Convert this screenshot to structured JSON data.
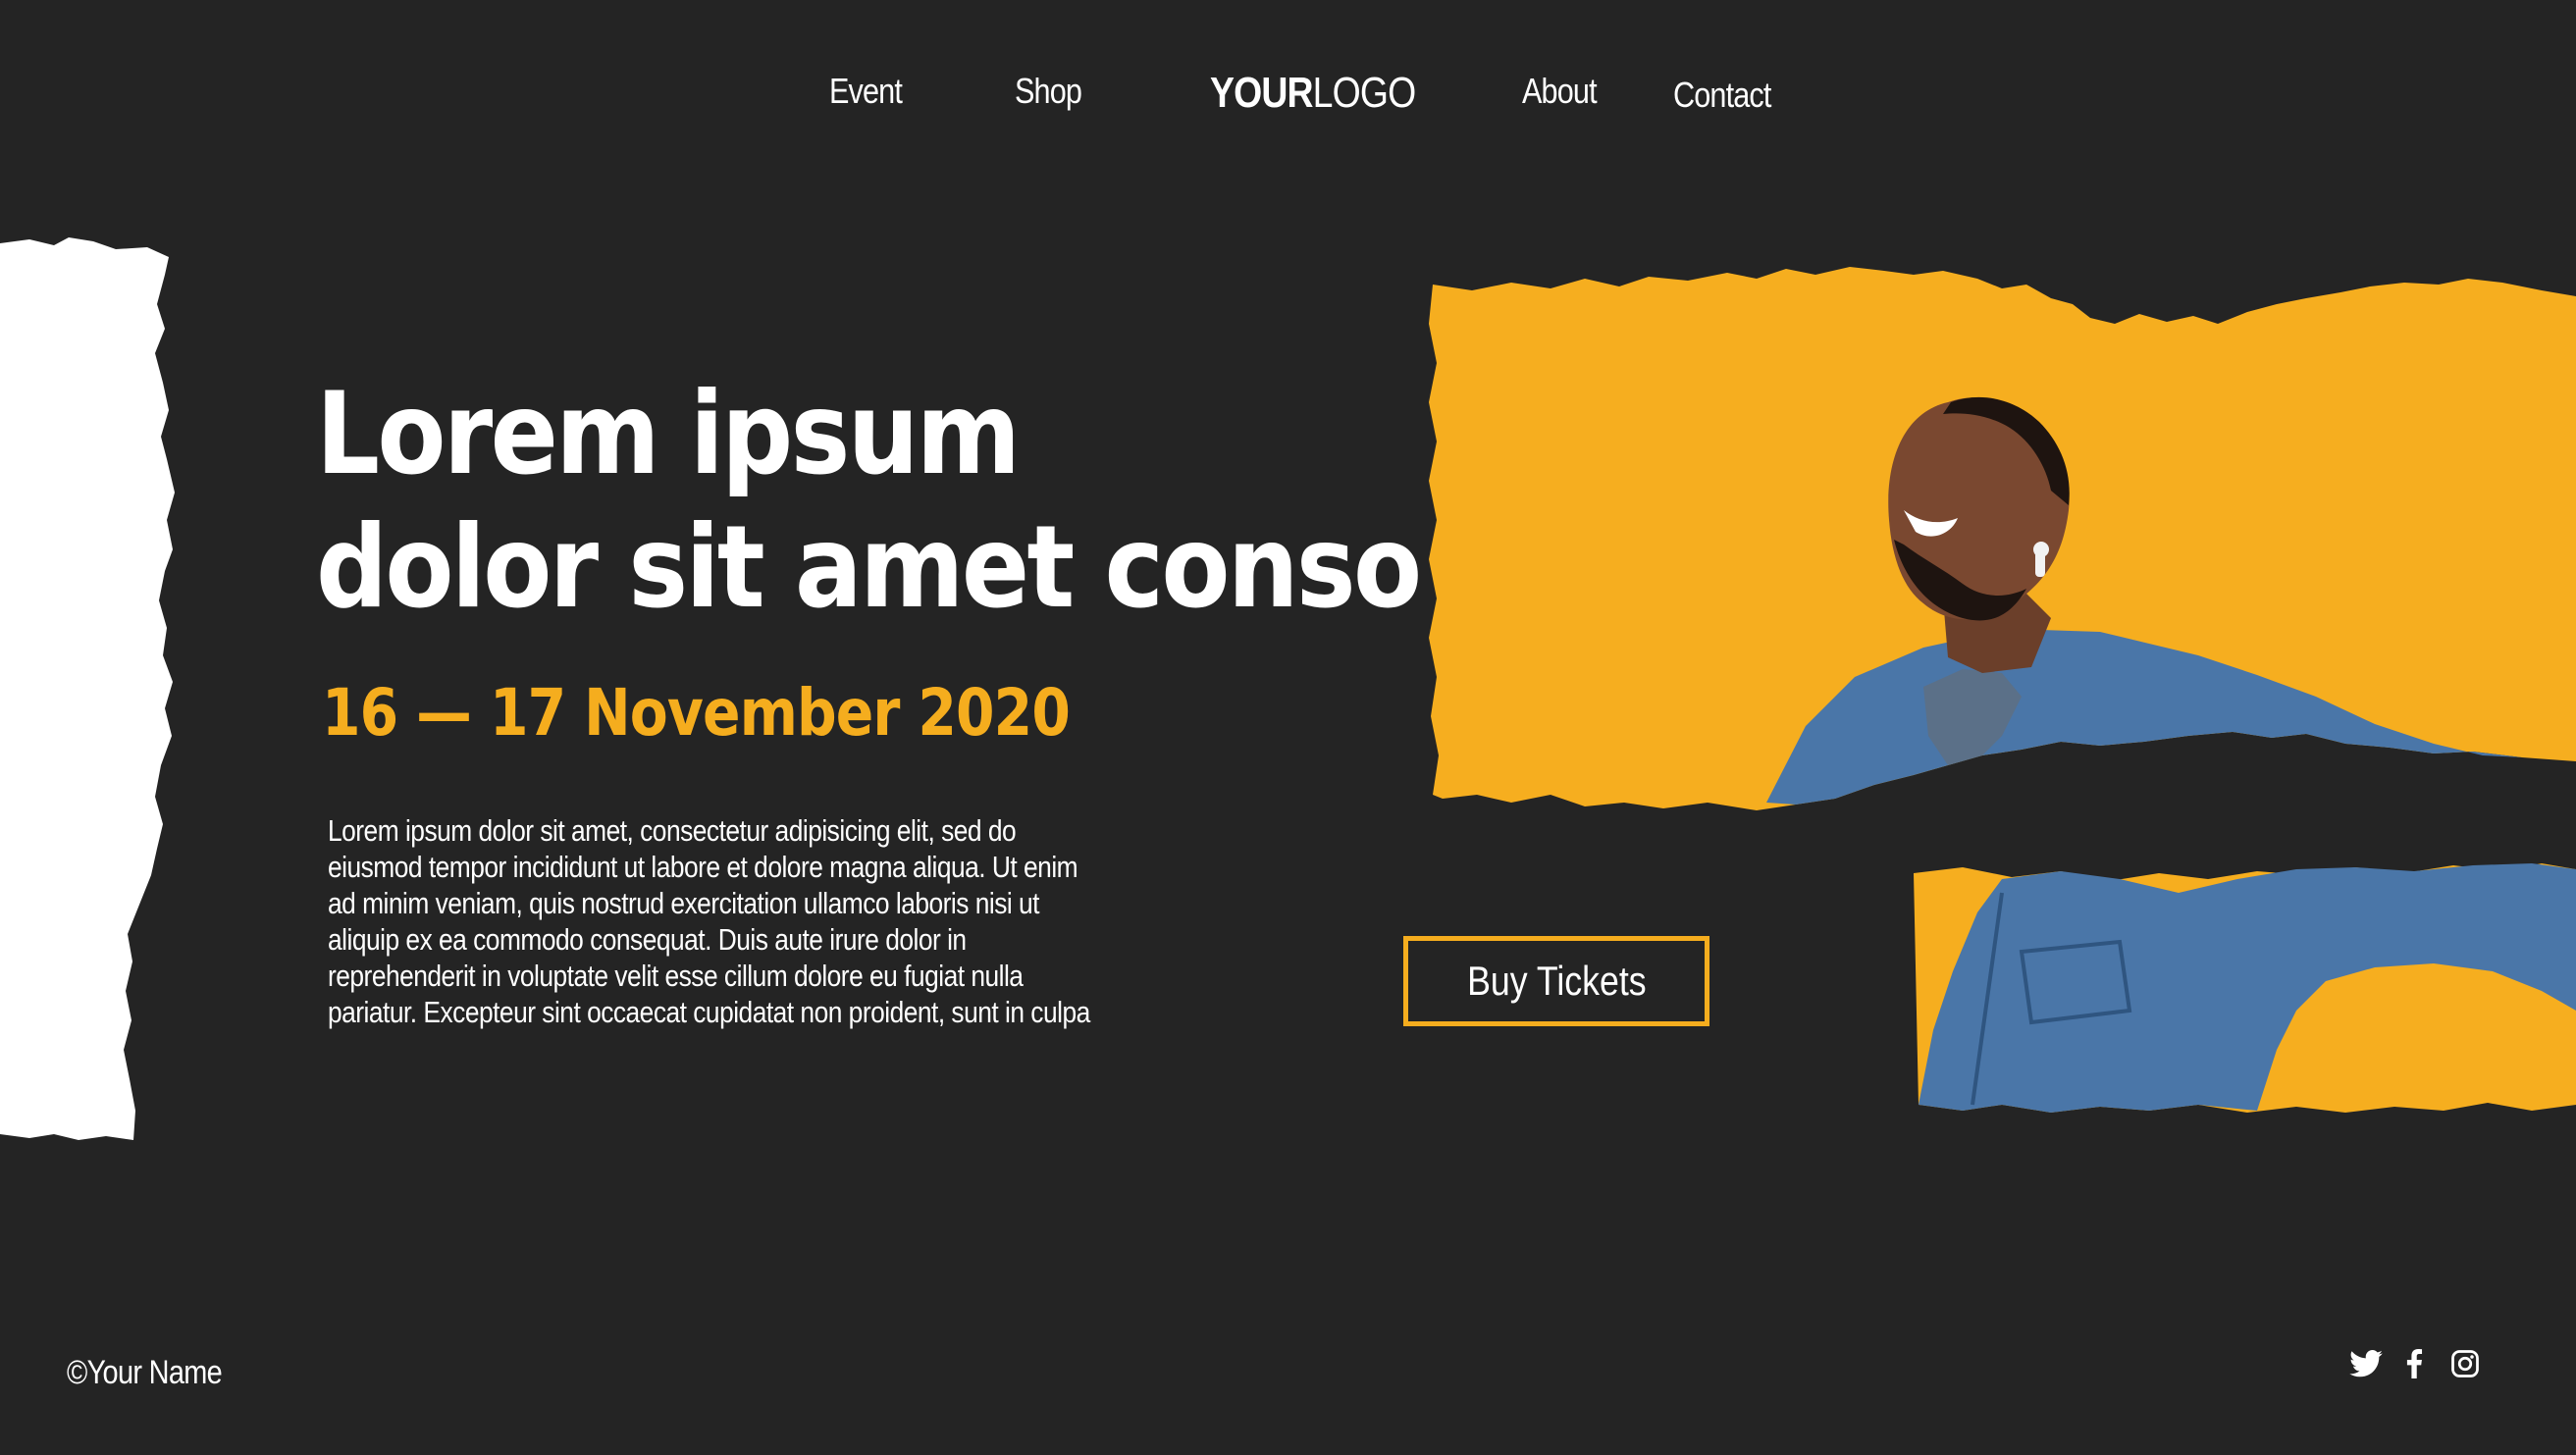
{
  "nav": {
    "links": [
      "Event",
      "Shop",
      "About",
      "Contact"
    ],
    "logo_bold": "YOUR",
    "logo_light": "LOGO"
  },
  "hero": {
    "headline_line1": "Lorem ipsum",
    "headline_line2": "dolor sit amet conso",
    "date": "16 — 17 November 2020",
    "body_lines": [
      "Lorem ipsum dolor sit amet, consectetur adipisicing elit, sed do",
      "eiusmod tempor incididunt ut labore et dolore magna aliqua. Ut enim",
      "ad minim veniam, quis nostrud exercitation ullamco laboris nisi ut",
      "aliquip ex ea commodo consequat. Duis aute irure dolor in",
      "reprehenderit in voluptate velit esse cillum dolore eu fugiat nulla",
      "pariatur. Excepteur sint occaecat cupidatat non proident, sunt in culpa"
    ],
    "cta_label": "Buy Tickets"
  },
  "footer": {
    "copyright": "©Your Name",
    "social_icons": [
      "twitter-icon",
      "facebook-icon",
      "instagram-icon"
    ]
  },
  "colors": {
    "background": "#242424",
    "accent": "#f5ad1e",
    "text": "#ffffff",
    "paper": "#ffffff"
  }
}
